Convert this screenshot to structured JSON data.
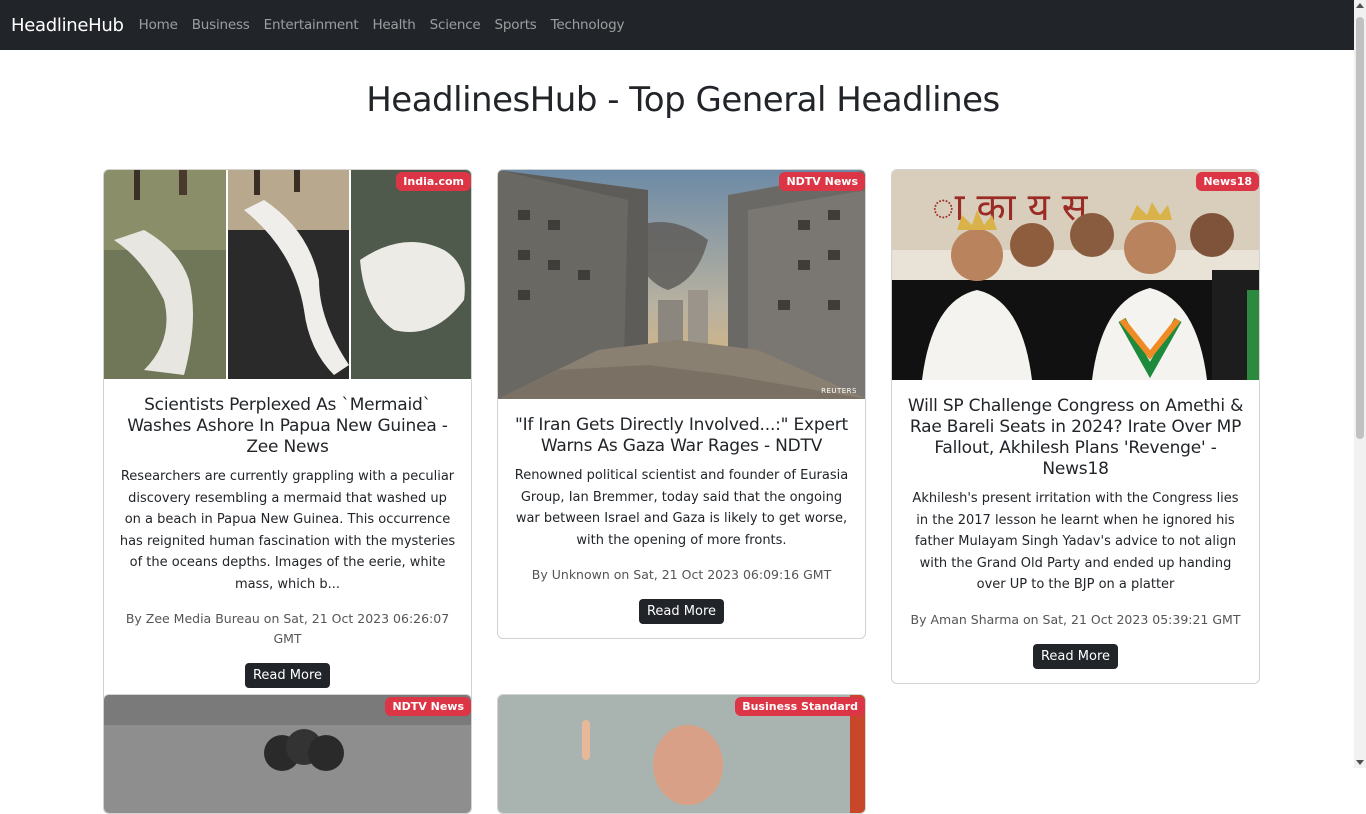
{
  "nav": {
    "brand": "HeadlineHub",
    "links": [
      "Home",
      "Business",
      "Entertainment",
      "Health",
      "Science",
      "Sports",
      "Technology"
    ]
  },
  "page": {
    "title": "HeadlinesHub - Top General Headlines"
  },
  "articles": [
    {
      "source": "India.com",
      "title": "Scientists Perplexed As `Mermaid` Washes Ashore In Papua New Guinea - Zee News",
      "description": "Researchers are currently grappling with a peculiar discovery resembling a mermaid that washed up on a beach in Papua New Guinea. This occurrence has reignited human fascination with the mysteries of the oceans depths. Images of the eerie, white mass, which b...",
      "meta": "By Zee Media Bureau on Sat, 21 Oct 2023 06:26:07 GMT",
      "button": "Read More"
    },
    {
      "source": "NDTV News",
      "title": "\"If Iran Gets Directly Involved...:\" Expert Warns As Gaza War Rages - NDTV",
      "description": "Renowned political scientist and founder of Eurasia Group, Ian Bremmer, today said that the ongoing war between Israel and Gaza is likely to get worse, with the opening of more fronts.",
      "meta": "By Unknown on Sat, 21 Oct 2023 06:09:16 GMT",
      "button": "Read More",
      "image_credit": "REUTERS"
    },
    {
      "source": "News18",
      "title": "Will SP Challenge Congress on Amethi & Rae Bareli Seats in 2024? Irate Over MP Fallout, Akhilesh Plans 'Revenge' - News18",
      "description": "Akhilesh's present irritation with the Congress lies in the 2017 lesson he learnt when he ignored his father Mulayam Singh Yadav's advice to not align with the Grand Old Party and ended up handing over UP to the BJP on a platter",
      "meta": "By Aman Sharma on Sat, 21 Oct 2023 05:39:21 GMT",
      "button": "Read More"
    },
    {
      "source": "NDTV News"
    },
    {
      "source": "Business Standard"
    }
  ],
  "colors": {
    "navbar": "#212529",
    "badge": "#dc3545",
    "button": "#212529"
  }
}
